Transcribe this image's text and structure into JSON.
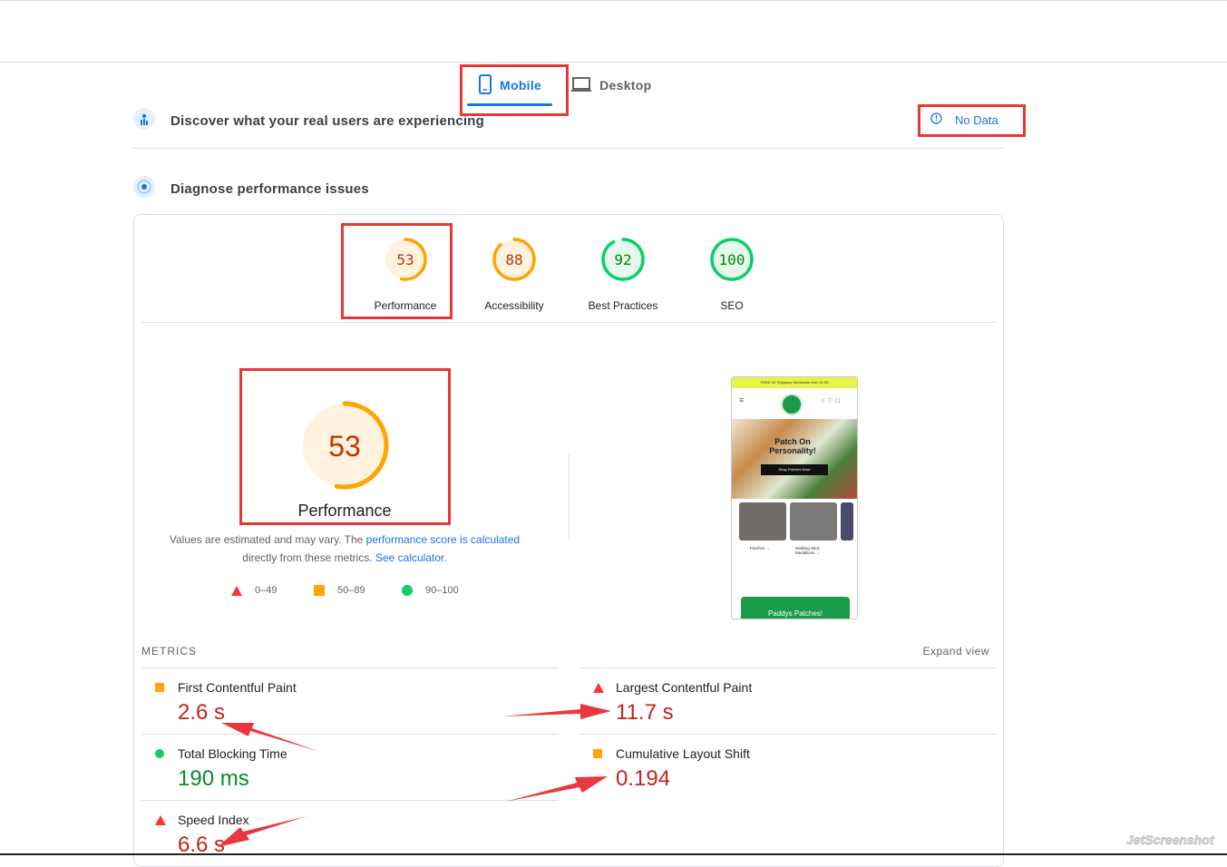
{
  "tabs": [
    {
      "label": "Mobile",
      "active": true
    },
    {
      "label": "Desktop",
      "active": false
    }
  ],
  "field_data": {
    "title": "Discover what your real users are experiencing",
    "status": "No Data"
  },
  "lab_data": {
    "title": "Diagnose performance issues"
  },
  "categories": [
    {
      "label": "Performance",
      "score": "53",
      "color": "#ffa400",
      "text_color": "#c33300",
      "bg": "#fff3e0",
      "fraction": 0.53
    },
    {
      "label": "Accessibility",
      "score": "88",
      "color": "#ffa400",
      "text_color": "#c33300",
      "bg": "#fff3e0",
      "fraction": 0.88
    },
    {
      "label": "Best Practices",
      "score": "92",
      "color": "#0cce6b",
      "text_color": "#008800",
      "bg": "#e6f8ed",
      "fraction": 0.92
    },
    {
      "label": "SEO",
      "score": "100",
      "color": "#0cce6b",
      "text_color": "#008800",
      "bg": "#e6f8ed",
      "fraction": 1.0
    }
  ],
  "big_gauge": {
    "score": "53",
    "label": "Performance",
    "fraction": 0.53
  },
  "explain": {
    "text1": "Values are estimated and may vary. The ",
    "link1": "performance score is calculated",
    "text2": "directly from these metrics. ",
    "link2": "See calculator."
  },
  "legend": [
    {
      "range": "0–49",
      "shape": "triangle",
      "color": "#ff3333"
    },
    {
      "range": "50–89",
      "shape": "square",
      "color": "#ffa400"
    },
    {
      "range": "90–100",
      "shape": "circle",
      "color": "#0cce6b"
    }
  ],
  "metrics_header": {
    "title": "METRICS",
    "expand": "Expand view"
  },
  "metrics": [
    {
      "name": "First Contentful Paint",
      "value": "2.6 s",
      "rating": "average"
    },
    {
      "name": "Largest Contentful Paint",
      "value": "11.7 s",
      "rating": "fail"
    },
    {
      "name": "Total Blocking Time",
      "value": "190 ms",
      "rating": "pass"
    },
    {
      "name": "Cumulative Layout Shift",
      "value": "0.194",
      "rating": "average"
    },
    {
      "name": "Speed Index",
      "value": "6.6 s",
      "rating": "fail"
    }
  ],
  "screenshot": {
    "banner": "FREE UK Shipping! Worldwide from £1.50",
    "hero_text": "Patch On Personality!",
    "hero_button": "Shop Patches Now!",
    "cat1": "Patches →",
    "cat2": "Walking Stick Medallions →",
    "footer": "Paddys Patches!"
  },
  "watermark": "JetScreenshot"
}
